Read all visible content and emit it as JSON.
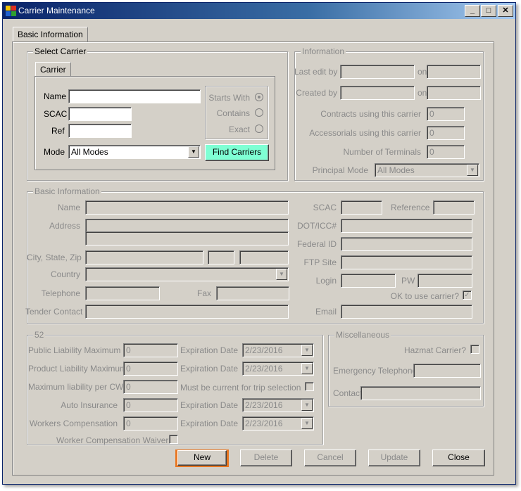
{
  "window": {
    "title": "Carrier Maintenance",
    "min": "_",
    "max": "□",
    "close": "✕"
  },
  "tabs": {
    "main": "Basic Information",
    "sub": "Carrier"
  },
  "select": {
    "legend": "Select Carrier",
    "name_label": "Name",
    "name_value": "",
    "scac_label": "SCAC",
    "scac_value": "",
    "ref_label": "Ref",
    "ref_value": "",
    "mode_label": "Mode",
    "mode_value": "All Modes",
    "starts_with": "Starts With",
    "contains": "Contains",
    "exact": "Exact",
    "find": "Find Carriers"
  },
  "info": {
    "legend": "Information",
    "last_edit": "Last edit by",
    "created": "Created by",
    "on": "on",
    "contracts": "Contracts using this carrier",
    "contracts_value": "0",
    "accessorials": "Accessorials using this carrier",
    "accessorials_value": "0",
    "terminals": "Number of Terminals",
    "terminals_value": "0",
    "principal": "Principal Mode",
    "principal_value": "All Modes"
  },
  "basic": {
    "legend": "Basic Information",
    "name": "Name",
    "address": "Address",
    "csz": "City, State, Zip",
    "country": "Country",
    "telephone": "Telephone",
    "fax": "Fax",
    "tender": "Tender Contact",
    "scac": "SCAC",
    "reference": "Reference",
    "dot": "DOT/ICC#",
    "federal": "Federal ID",
    "ftp": "FTP Site",
    "login": "Login",
    "pw": "PW",
    "ok": "OK to use carrier?",
    "email": "Email",
    "ok_check": "✓"
  },
  "insurance": {
    "legend": "52",
    "public": "Public Liability Maximum",
    "product": "Product Liability Maximum",
    "maxcwt": "Maximum liability per CWT",
    "auto": "Auto Insurance",
    "workers": "Workers Compensation",
    "waiver": "Worker Compensation Waiver",
    "exp": "Expiration Date",
    "must": "Must be current for trip selection",
    "zero": "0",
    "date": "2/23/2016"
  },
  "misc": {
    "legend": "Miscellaneous",
    "hazmat": "Hazmat Carrier?",
    "emergency": "Emergency Telephone",
    "contact": "Contact"
  },
  "buttons": {
    "new": "New",
    "delete": "Delete",
    "cancel": "Cancel",
    "update": "Update",
    "close": "Close"
  },
  "colors": {
    "accent": "#e87722",
    "find": "#7fffd4"
  }
}
